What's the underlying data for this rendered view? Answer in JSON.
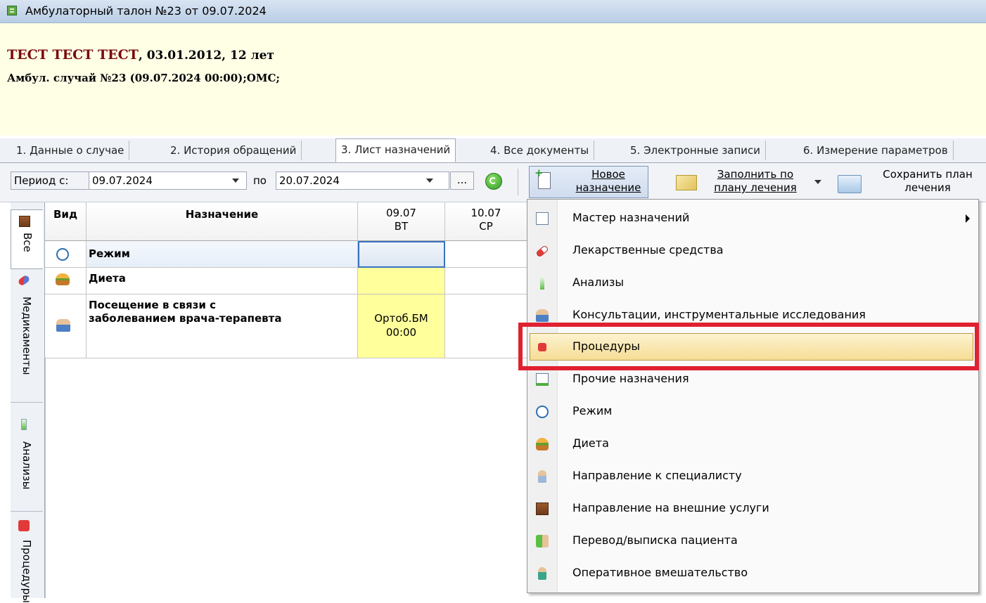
{
  "window": {
    "title": "Амбулаторный талон №23 от 09.07.2024"
  },
  "patient": {
    "name": "ТЕСТ ТЕСТ ТЕСТ",
    "details": ", 03.01.2012, 12 лет",
    "case": "Амбул. случай №23 (09.07.2024 00:00);ОМС;"
  },
  "tabs": [
    {
      "label": "1. Данные о случае"
    },
    {
      "label": "2. История обращений"
    },
    {
      "label": "3. Лист назначений",
      "active": true
    },
    {
      "label": "4. Все документы"
    },
    {
      "label": "5. Электронные записи"
    },
    {
      "label": "6. Измерение параметров"
    }
  ],
  "toolbar": {
    "period_label": "Период с:",
    "date_from": "09.07.2024",
    "to_label": "по",
    "date_to": "20.07.2024",
    "ellipsis": "...",
    "new_line1": "Новое",
    "new_line2": "назначение",
    "fill_line1": "Заполнить по",
    "fill_line2": "плану лечения",
    "save_line1": "Сохранить план",
    "save_line2": "лечения"
  },
  "side_tabs": [
    {
      "label": "Все",
      "active": true
    },
    {
      "label": "Медикаменты"
    },
    {
      "label": "Анализы"
    },
    {
      "label": "Процедуры"
    }
  ],
  "grid": {
    "headers": {
      "kind": "Вид",
      "assignment": "Назначение",
      "d1_date": "09.07",
      "d1_day": "ВТ",
      "d2_date": "10.07",
      "d2_day": "СР"
    },
    "rows": [
      {
        "name": "Режим",
        "icon": "regime-icon"
      },
      {
        "name": "Диета",
        "icon": "diet-icon"
      },
      {
        "name_line1": "Посещение в связи с",
        "name_line2": "заболеванием врача-терапевта",
        "icon": "visit-icon",
        "d1_line1": "Ортоб.БМ",
        "d1_line2": "00:00"
      }
    ]
  },
  "menu": {
    "items": [
      {
        "label": "Мастер назначений",
        "submenu": true
      },
      {
        "label": "Лекарственные средства"
      },
      {
        "label": "Анализы"
      },
      {
        "label": "Консультации, инструментальные исследования"
      },
      {
        "label": "Процедуры",
        "highlighted": true
      },
      {
        "label": "Прочие назначения"
      },
      {
        "label": "Режим"
      },
      {
        "label": "Диета"
      },
      {
        "label": "Направление к специалисту"
      },
      {
        "label": "Направление на внешние услуги"
      },
      {
        "label": "Перевод/выписка пациента"
      },
      {
        "label": "Оперативное вмешательство"
      }
    ]
  },
  "colors": {
    "highlight_outline": "#e02130",
    "patient_name": "#7a0c0c",
    "date_cell": "#ffff9c"
  }
}
